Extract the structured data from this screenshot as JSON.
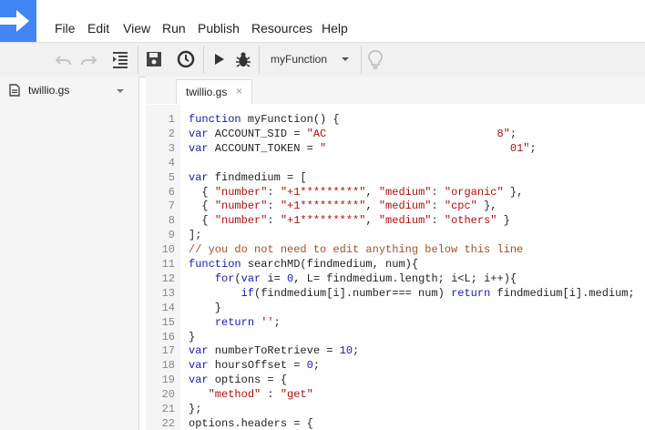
{
  "menu": [
    "File",
    "Edit",
    "View",
    "Run",
    "Publish",
    "Resources",
    "Help"
  ],
  "toolbar": {
    "function_select": "myFunction",
    "icons": [
      "undo-icon",
      "redo-icon",
      "indent-icon",
      "save-icon",
      "triggers-icon",
      "run-icon",
      "debug-icon",
      "lightbulb-icon"
    ]
  },
  "files": {
    "items": [
      {
        "name": "twillio.gs"
      }
    ]
  },
  "editor": {
    "tab": {
      "label": "twillio.gs",
      "close": "×"
    },
    "lines": [
      {
        "n": "1",
        "t": "function myFunction() {"
      },
      {
        "n": "2",
        "t": "var ACCOUNT_SID = \"AC                          8\";"
      },
      {
        "n": "3",
        "t": "var ACCOUNT_TOKEN = \"                            01\";"
      },
      {
        "n": "4",
        "t": ""
      },
      {
        "n": "5",
        "t": "var findmedium = ["
      },
      {
        "n": "6",
        "t": "  { \"number\": \"+1*********\", \"medium\": \"organic\" },"
      },
      {
        "n": "7",
        "t": "  { \"number\": \"+1*********\", \"medium\": \"cpc\" },"
      },
      {
        "n": "8",
        "t": "  { \"number\": \"+1*********\", \"medium\": \"others\" }"
      },
      {
        "n": "9",
        "t": "];"
      },
      {
        "n": "10",
        "t": "// you do not need to edit anything below this line"
      },
      {
        "n": "11",
        "t": "function searchMD(findmedium, num){"
      },
      {
        "n": "12",
        "t": "    for(var i= 0, L= findmedium.length; i<L; i++){"
      },
      {
        "n": "13",
        "t": "        if(findmedium[i].number=== num) return findmedium[i].medium;"
      },
      {
        "n": "14",
        "t": "    }"
      },
      {
        "n": "15",
        "t": "    return '';"
      },
      {
        "n": "16",
        "t": "}"
      },
      {
        "n": "17",
        "t": "var numberToRetrieve = 10;"
      },
      {
        "n": "18",
        "t": "var hoursOffset = 0;"
      },
      {
        "n": "19",
        "t": "var options = {"
      },
      {
        "n": "20",
        "t": "   \"method\" : \"get\""
      },
      {
        "n": "21",
        "t": "};"
      },
      {
        "n": "22",
        "t": "options.headers = {"
      }
    ]
  }
}
